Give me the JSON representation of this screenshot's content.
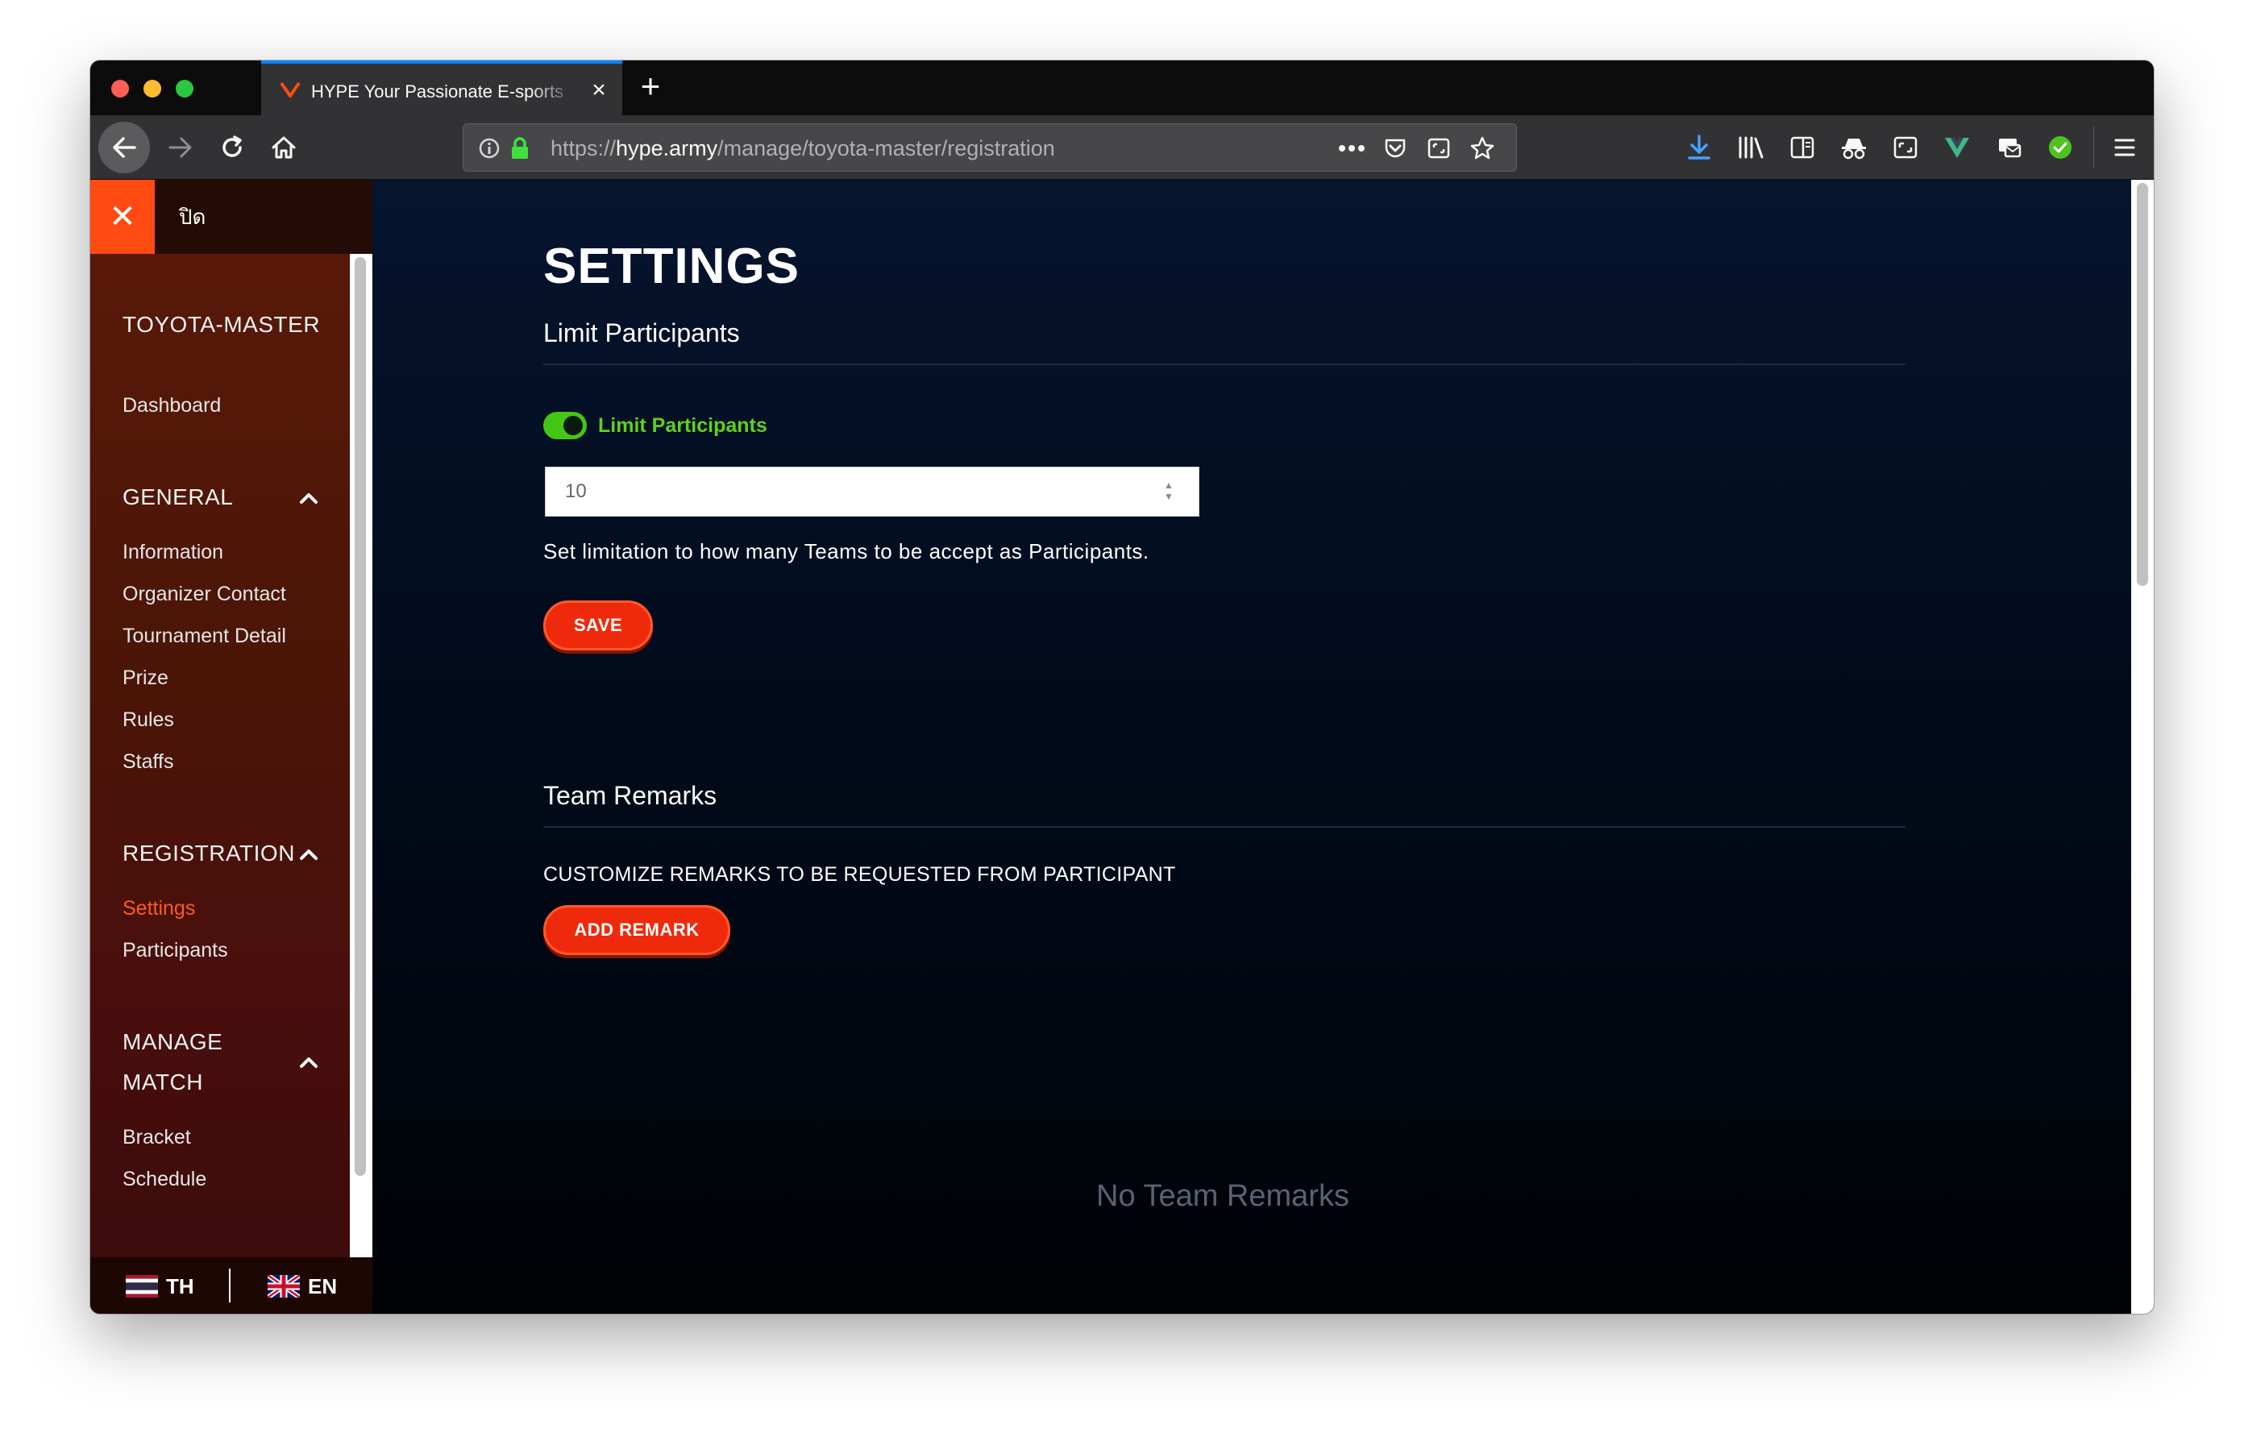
{
  "browser": {
    "tab_title": "HYPE Your Passionate E-sports",
    "url_scheme": "https://",
    "url_host": "hype.army",
    "url_path": "/manage/toyota-master/registration"
  },
  "sidebar": {
    "close_label": "ปิด",
    "tournament": "TOYOTA-MASTER",
    "dashboard": "Dashboard",
    "general": {
      "heading": "GENERAL",
      "items": [
        "Information",
        "Organizer Contact",
        "Tournament Detail",
        "Prize",
        "Rules",
        "Staffs"
      ]
    },
    "registration": {
      "heading": "REGISTRATION",
      "items": [
        "Settings",
        "Participants"
      ],
      "active": "Settings"
    },
    "manage_match": {
      "heading_line1": "MANAGE",
      "heading_line2": "MATCH",
      "items": [
        "Bracket",
        "Schedule"
      ]
    },
    "languages": [
      "TH",
      "EN"
    ]
  },
  "main": {
    "title": "SETTINGS",
    "limit_section": {
      "title": "Limit Participants",
      "toggle_label": "Limit Participants",
      "toggle_on": true,
      "input_value": "10",
      "helper": "Set limitation to how many Teams to be accept as Participants.",
      "save_label": "SAVE"
    },
    "remarks_section": {
      "title": "Team Remarks",
      "caption": "CUSTOMIZE REMARKS TO BE REQUESTED FROM PARTICIPANT",
      "add_label": "ADD REMARK",
      "empty_text": "No Team Remarks"
    }
  },
  "colors": {
    "accent": "#ef2a0c",
    "active_link": "#ff5a1f",
    "toggle_on": "#44c616"
  }
}
